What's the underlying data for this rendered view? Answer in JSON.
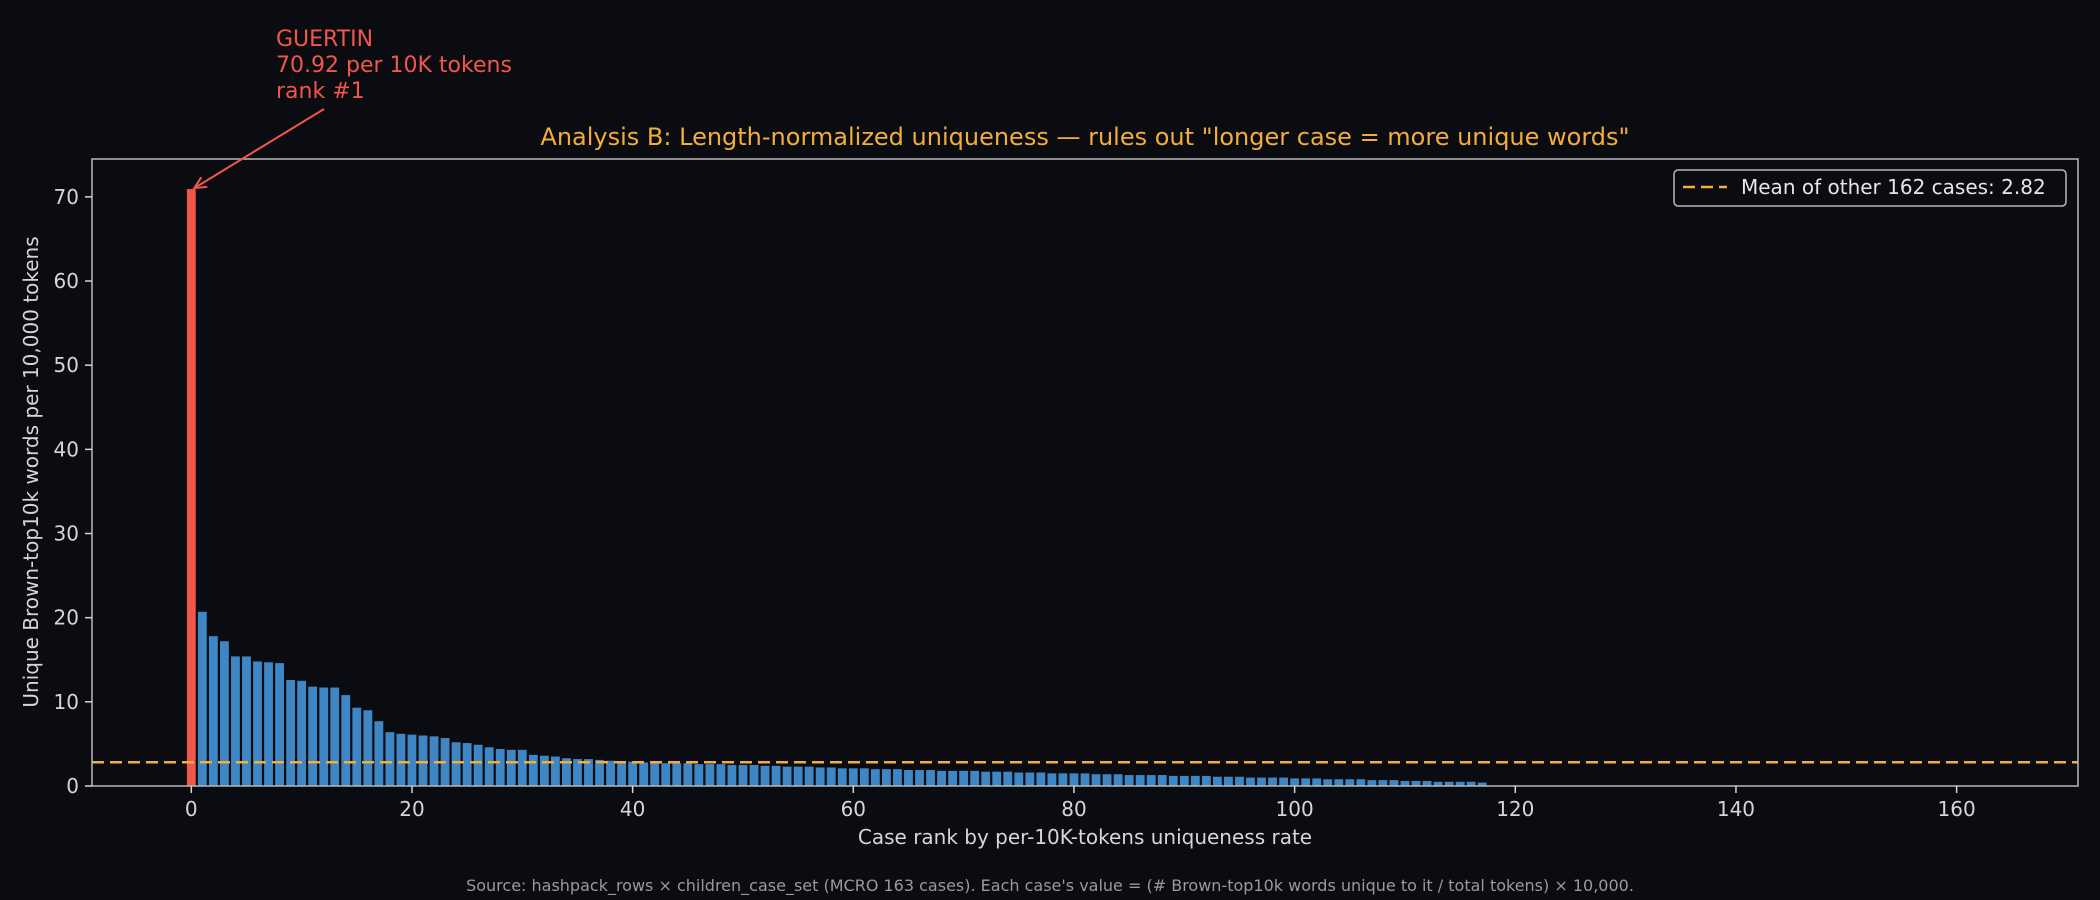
{
  "chart_data": {
    "type": "bar",
    "title": "Analysis B: Length-normalized uniqueness — rules out \"longer case = more unique words\"",
    "xlabel": "Case rank by per-10K-tokens uniqueness rate",
    "ylabel": "Unique Brown-top10k words per 10,000 tokens",
    "xlim": [
      -9,
      171
    ],
    "ylim": [
      0,
      74.5
    ],
    "xticks": [
      0,
      20,
      40,
      60,
      80,
      100,
      120,
      140,
      160
    ],
    "yticks": [
      0,
      10,
      20,
      30,
      40,
      50,
      60,
      70
    ],
    "grid": false,
    "highlight": {
      "x": 0,
      "value": 70.92,
      "color": "#f0564a"
    },
    "bar_color": "#3f86c4",
    "values": [
      70.92,
      20.7,
      17.8,
      17.2,
      15.4,
      15.4,
      14.8,
      14.7,
      14.6,
      12.6,
      12.5,
      11.8,
      11.7,
      11.7,
      10.8,
      9.3,
      9.0,
      7.7,
      6.4,
      6.2,
      6.1,
      6.0,
      5.9,
      5.7,
      5.2,
      5.1,
      4.9,
      4.6,
      4.4,
      4.3,
      4.3,
      3.7,
      3.6,
      3.5,
      3.3,
      3.2,
      3.2,
      3.1,
      3.0,
      2.9,
      2.9,
      2.8,
      2.8,
      2.7,
      2.7,
      2.7,
      2.6,
      2.6,
      2.6,
      2.5,
      2.5,
      2.5,
      2.4,
      2.4,
      2.3,
      2.3,
      2.3,
      2.2,
      2.2,
      2.1,
      2.1,
      2.1,
      2.0,
      2.0,
      2.0,
      1.9,
      1.9,
      1.9,
      1.8,
      1.8,
      1.8,
      1.8,
      1.7,
      1.7,
      1.7,
      1.6,
      1.6,
      1.6,
      1.5,
      1.5,
      1.5,
      1.5,
      1.4,
      1.4,
      1.4,
      1.3,
      1.3,
      1.3,
      1.3,
      1.2,
      1.2,
      1.2,
      1.2,
      1.1,
      1.1,
      1.1,
      1.0,
      1.0,
      1.0,
      1.0,
      0.9,
      0.9,
      0.9,
      0.8,
      0.8,
      0.8,
      0.8,
      0.7,
      0.7,
      0.7,
      0.6,
      0.6,
      0.6,
      0.5,
      0.5,
      0.5,
      0.5,
      0.4,
      0,
      0,
      0,
      0,
      0,
      0,
      0,
      0,
      0,
      0,
      0,
      0,
      0,
      0,
      0,
      0,
      0,
      0,
      0,
      0,
      0,
      0,
      0,
      0,
      0,
      0,
      0,
      0,
      0,
      0,
      0,
      0,
      0,
      0,
      0,
      0,
      0,
      0,
      0,
      0,
      0,
      0,
      0,
      0,
      0,
      0,
      0,
      0,
      0,
      0
    ],
    "mean_line": {
      "value": 2.82,
      "color": "#f2ad3a",
      "label": "Mean of other 162 cases: 2.82"
    },
    "legend_placement": "top-right",
    "annotation": {
      "lines": [
        "GUERTIN",
        "70.92 per 10K tokens",
        "rank #1"
      ],
      "target": {
        "x": 0,
        "y": 70.92
      },
      "color": "#f0564a"
    },
    "source_note": "Source: hashpack_rows × children_case_set (MCRO 163 cases). Each case's value = (# Brown-top10k words unique to it / total tokens) × 10,000."
  }
}
